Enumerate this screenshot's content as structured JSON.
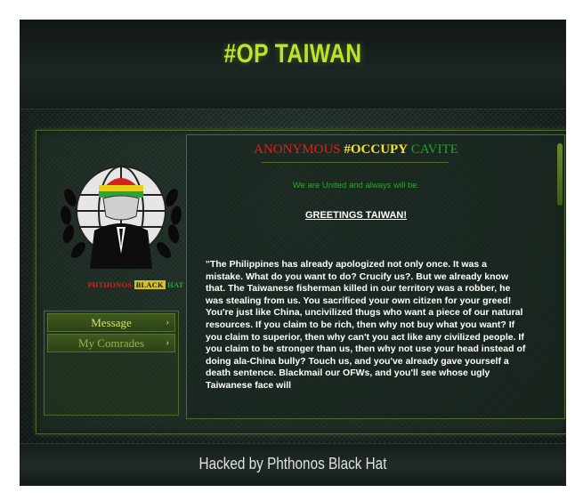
{
  "header": {
    "title": "#OP TAIWAN"
  },
  "logo": {
    "caption_red": "PHTHONOS",
    "caption_yellow": "BLACK",
    "caption_green": "HAT"
  },
  "nav": {
    "items": [
      {
        "label": "Message",
        "chevron": "›"
      },
      {
        "label": "My Comrades",
        "chevron": "›"
      }
    ]
  },
  "content": {
    "occupy_red": "ANONYMOUS",
    "occupy_yellow": "#OCCUPY",
    "occupy_green": "CAVITE",
    "motto": "We are United and always will be.",
    "greeting": "GREETINGS TAIWAN!",
    "body": "\"The Philippines has already apologized not only once. It was a mistake. What do you want to do? Crucify us?. But we already know that. The Taiwanese fisherman killed in our territory was a robber, he was stealing from us. You sacrificed your own citizen for your greed! You're just like China, uncivilized thugs who want a piece of our natural resources. If you claim to be rich, then why not buy what you want? If you claim to superior, then why can't you act like any civilized people. If you claim to be stronger than us, then why not use your head instead of doing ala-China bully? Touch us, and you've already gave yourself a death sentence. Blackmail our OFWs, and you'll see whose ugly Taiwanese face will"
  },
  "footer": {
    "text": "Hacked by Phthonos Black Hat"
  },
  "colors": {
    "accent_green": "#bfe22b",
    "red": "#e02020",
    "yellow": "#f3e226",
    "green": "#1fa12e"
  }
}
